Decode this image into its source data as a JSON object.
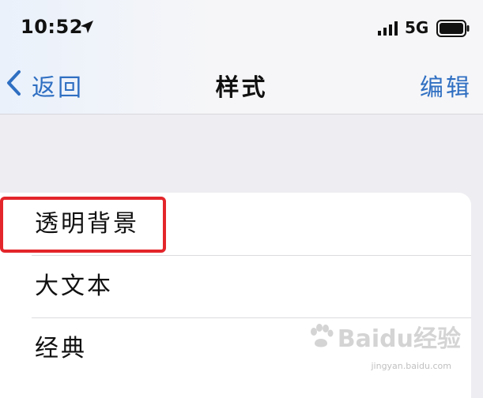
{
  "status_bar": {
    "time": "10:52",
    "network": "5G",
    "icons": [
      "location-arrow-icon",
      "cellular-signal-icon",
      "battery-icon"
    ]
  },
  "nav": {
    "back_label": "返回",
    "title": "样式",
    "edit_label": "编辑"
  },
  "list": {
    "items": [
      {
        "label": "透明背景",
        "highlighted": true
      },
      {
        "label": "大文本"
      },
      {
        "label": "经典"
      }
    ]
  },
  "colors": {
    "accent": "#2f6fc2",
    "highlight": "#e3262b",
    "background": "#eeeef2"
  },
  "watermark": {
    "text": "Baidu经验",
    "sub": "jingyan.baidu.com"
  }
}
